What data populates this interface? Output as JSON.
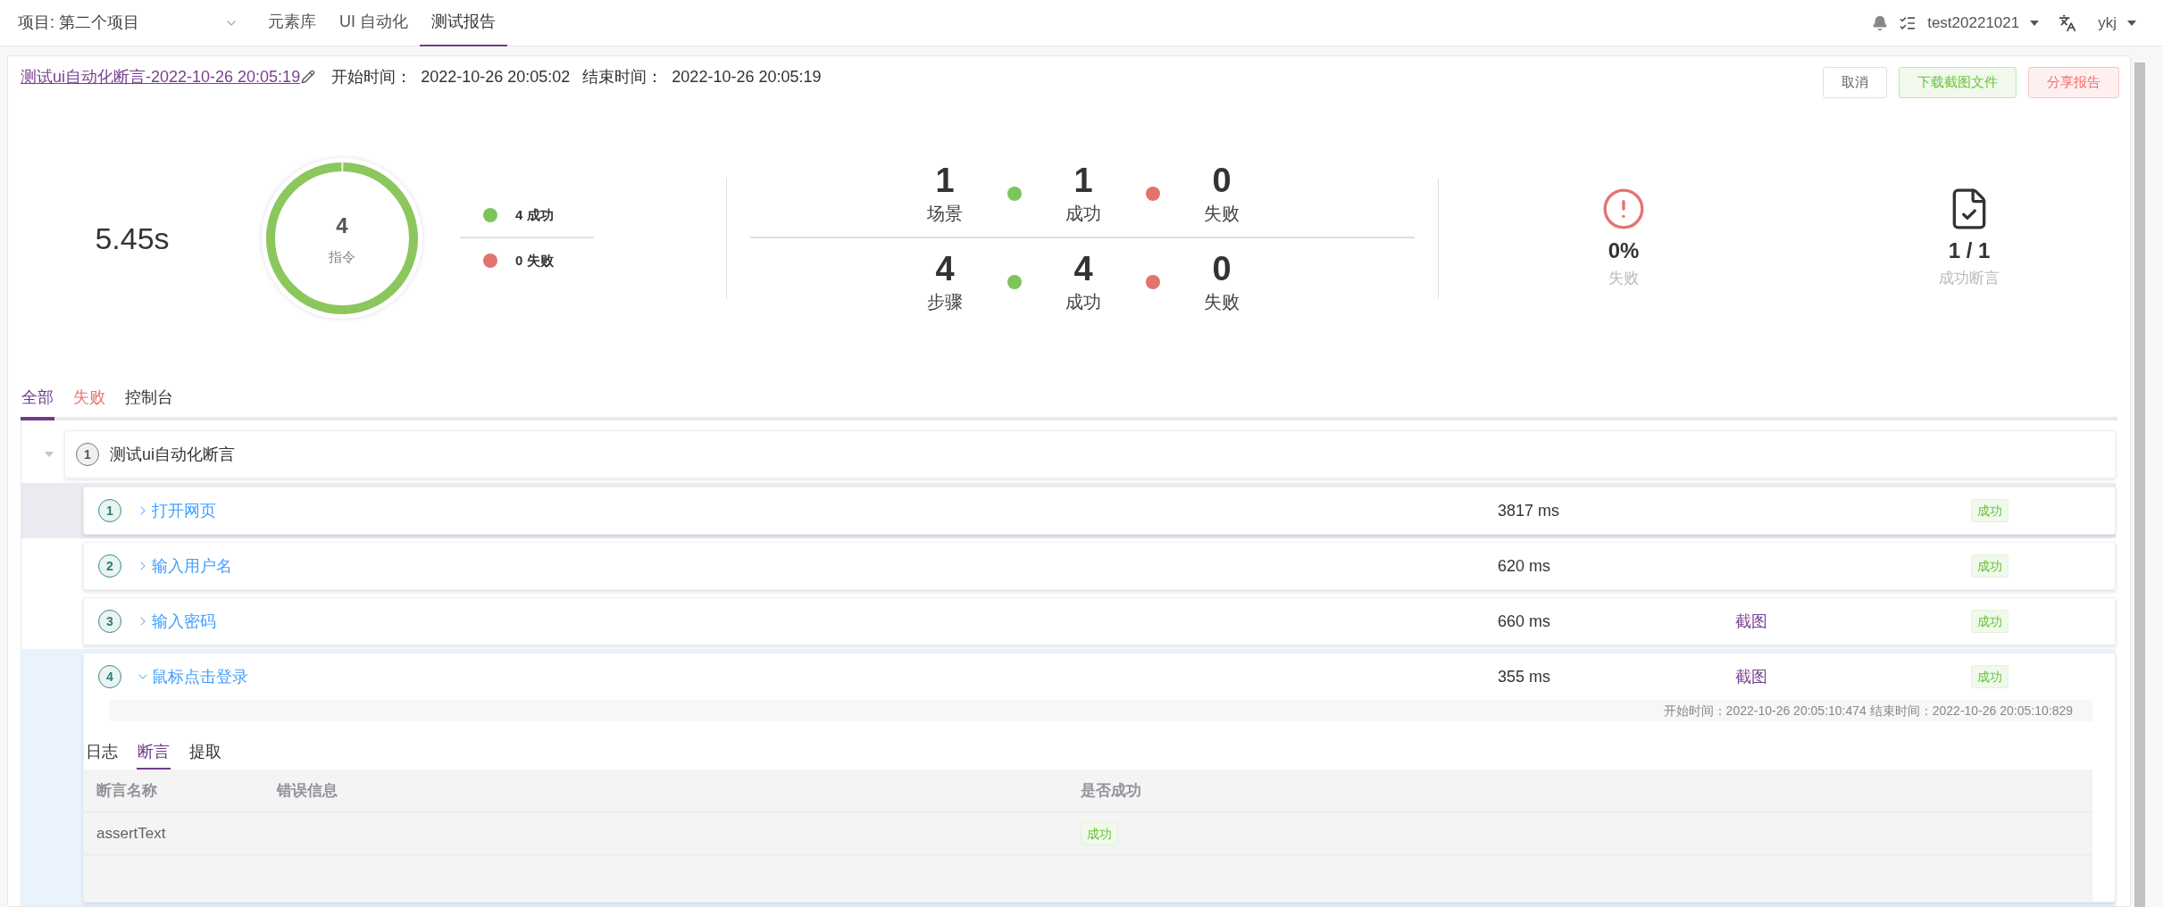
{
  "top_nav": {
    "project_select": "项目: 第二个项目",
    "tabs": [
      {
        "label": "元素库",
        "selected": false
      },
      {
        "label": "UI 自动化",
        "selected": false
      },
      {
        "label": "测试报告",
        "selected": true
      }
    ],
    "workspace": "test20221021",
    "user": "ykj"
  },
  "report_header": {
    "title": "测试ui自动化断言-2022-10-26 20:05:19",
    "start_label": "开始时间：",
    "start_time": "2022-10-26 20:05:02",
    "end_label": "结束时间：",
    "end_time": "2022-10-26 20:05:19",
    "buttons": [
      {
        "label": "取消",
        "kind": "default"
      },
      {
        "label": "下载截图文件",
        "kind": "success"
      },
      {
        "label": "分享报告",
        "kind": "danger"
      }
    ]
  },
  "summary": {
    "duration": "5.45s",
    "commands": {
      "count": "4",
      "label": "指令",
      "level": 1
    },
    "legend": [
      {
        "text": "4 成功",
        "color": "#7dc45a"
      },
      {
        "text": "0 失败",
        "color": "#e5736d"
      }
    ],
    "counts": [
      {
        "total": "1",
        "total_label": "场景",
        "passed": "1",
        "passed_label": "成功",
        "failed": "0",
        "failed_label": "失败"
      },
      {
        "total": "4",
        "total_label": "步骤",
        "passed": "4",
        "passed_label": "成功",
        "failed": "0",
        "failed_label": "失败"
      }
    ],
    "fail_rate": {
      "value": "0%",
      "label": "失败"
    },
    "assertions": {
      "value": "1 / 1",
      "label": "成功断言"
    }
  },
  "result_tabs": [
    {
      "label": "全部",
      "kind": "all",
      "selected": true
    },
    {
      "label": "失败",
      "kind": "failed",
      "selected": false
    },
    {
      "label": "控制台",
      "kind": "console",
      "selected": false
    }
  ],
  "scenario": {
    "index": "1",
    "name": "测试ui自动化断言",
    "expanded": true,
    "steps": [
      {
        "index": "1",
        "name": "打开网页",
        "duration": "3817 ms",
        "status": "成功",
        "hovered": true,
        "expanded": false
      },
      {
        "index": "2",
        "name": "输入用户名",
        "duration": "620 ms",
        "status": "成功",
        "hovered": false,
        "expanded": false
      },
      {
        "index": "3",
        "name": "输入密码",
        "duration": "660 ms",
        "screenshot": "截图",
        "status": "成功",
        "hovered": false,
        "expanded": false
      },
      {
        "index": "4",
        "name": "鼠标点击登录",
        "duration": "355 ms",
        "screenshot": "截图",
        "status": "成功",
        "hovered": false,
        "expanded": true,
        "detail": {
          "timing": "开始时间：2022-10-26 20:05:10:474 结束时间：2022-10-26 20:05:10:829",
          "tabs": [
            {
              "label": "日志",
              "selected": false
            },
            {
              "label": "断言",
              "selected": true
            },
            {
              "label": "提取",
              "selected": false
            }
          ],
          "table": {
            "columns": [
              "断言名称",
              "错误信息",
              "是否成功"
            ],
            "rows": [
              {
                "name": "assertText",
                "status": "成功"
              }
            ]
          }
        }
      }
    ]
  }
}
